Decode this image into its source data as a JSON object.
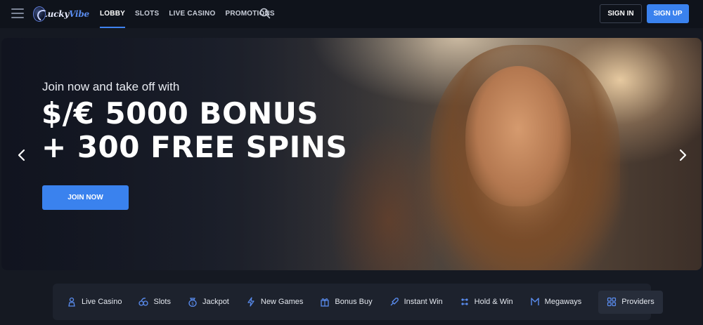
{
  "brand": {
    "logo_text_1": "Lucky",
    "logo_text_2": "Vibe"
  },
  "nav": {
    "items": [
      {
        "label": "LOBBY",
        "active": true
      },
      {
        "label": "SLOTS",
        "active": false
      },
      {
        "label": "LIVE CASINO",
        "active": false
      },
      {
        "label": "PROMOTIONS",
        "active": false
      }
    ]
  },
  "auth": {
    "signin_label": "SIGN IN",
    "signup_label": "SIGN UP"
  },
  "hero": {
    "subtitle": "Join now and take off with",
    "title_line1": "$/€ 5000 BONUS",
    "title_line2": "+ 300 FREE SPINS",
    "cta_label": "JOIN NOW"
  },
  "categories": [
    {
      "label": "Live Casino",
      "icon": "live-casino-icon"
    },
    {
      "label": "Slots",
      "icon": "slots-icon"
    },
    {
      "label": "Jackpot",
      "icon": "jackpot-icon"
    },
    {
      "label": "New Games",
      "icon": "new-games-icon"
    },
    {
      "label": "Bonus Buy",
      "icon": "bonus-buy-icon"
    },
    {
      "label": "Instant Win",
      "icon": "instant-win-icon"
    },
    {
      "label": "Hold & Win",
      "icon": "hold-win-icon"
    },
    {
      "label": "Megaways",
      "icon": "megaways-icon"
    },
    {
      "label": "Providers",
      "icon": "providers-icon"
    }
  ],
  "colors": {
    "accent": "#3a82ee",
    "background": "#151922",
    "topbar": "#0f131b",
    "category_bar": "#1d222d"
  }
}
